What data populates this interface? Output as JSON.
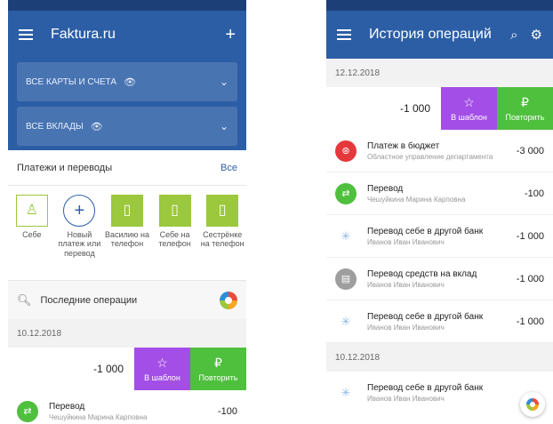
{
  "colors": {
    "primary": "#2c5ea6",
    "accent_green": "#9bc83c",
    "swipe_purple": "#a34ee6",
    "swipe_green": "#4fbf3e"
  },
  "left": {
    "app_title": "Faktura.ru",
    "cards": [
      {
        "label": "ВСЕ КАРТЫ И СЧЕТА"
      },
      {
        "label": "ВСЕ ВКЛАДЫ"
      }
    ],
    "payments_title": "Платежи и переводы",
    "all_link": "Все",
    "quick_actions": [
      {
        "label": "Себе",
        "icon": "person-icon"
      },
      {
        "label": "Новый платеж или перевод",
        "icon": "plus-icon"
      },
      {
        "label": "Василию на телефон",
        "icon": "phone-icon"
      },
      {
        "label": "Себе на телефон",
        "icon": "phone-icon"
      },
      {
        "label": "Сестрёнке на телефон",
        "icon": "phone-icon"
      }
    ],
    "recent_title": "Последние операции",
    "date": "10.12.2018",
    "swipe": {
      "amount": "-1 000",
      "template_label": "В шаблон",
      "repeat_label": "Повторить"
    },
    "ops": [
      {
        "name": "Перевод",
        "sub": "Чешуйкина Марина Карповна",
        "amount": "-100"
      }
    ]
  },
  "right": {
    "title": "История операций",
    "date1": "12.12.2018",
    "swipe": {
      "amount": "-1 000",
      "template_label": "В шаблон",
      "repeat_label": "Повторить"
    },
    "ops": [
      {
        "name": "Платеж в бюджет",
        "sub": "Областное управление департамента",
        "amount": "-3 000",
        "icon": "coins-icon"
      },
      {
        "name": "Перевод",
        "sub": "Чешуйкина Марина Карповна",
        "amount": "-100",
        "icon": "transfer-icon"
      },
      {
        "name": "Перевод себе в другой банк",
        "sub": "Иванов Иван Иванович",
        "amount": "-1 000",
        "icon": "spinner-icon"
      },
      {
        "name": "Перевод средств на вклад",
        "sub": "Иванов Иван Иванович",
        "amount": "-1 000",
        "icon": "deposit-icon"
      },
      {
        "name": "Перевод себе в другой банк",
        "sub": "Иванов Иван Иванович",
        "amount": "-1 000",
        "icon": "spinner-icon"
      }
    ],
    "date2": "10.12.2018",
    "last_op": {
      "name": "Перевод себе в другой банк",
      "sub": "Иванов Иван Иванович"
    }
  }
}
